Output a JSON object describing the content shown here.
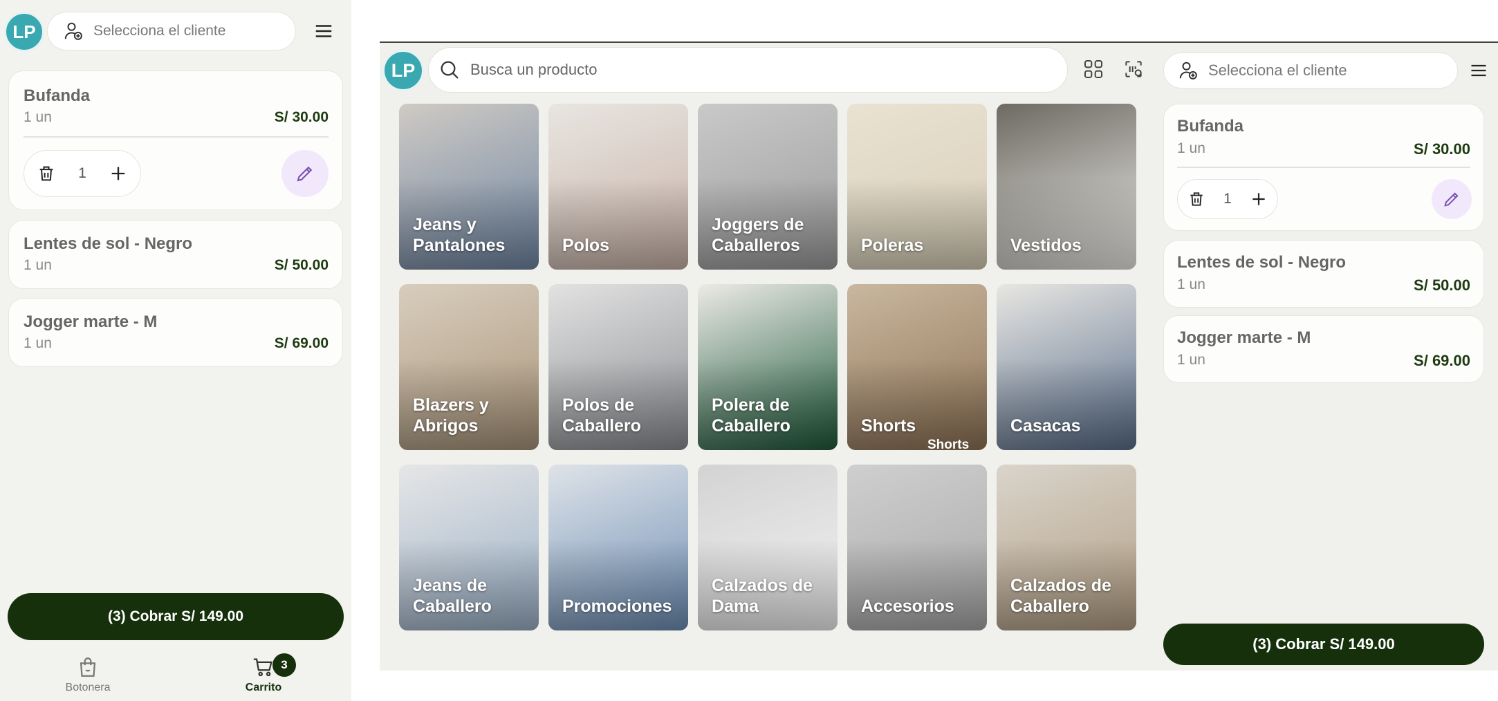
{
  "user": {
    "initials": "LP"
  },
  "client_picker": {
    "placeholder": "Selecciona el cliente"
  },
  "search": {
    "placeholder": "Busca un producto"
  },
  "cart": {
    "items": [
      {
        "name": "Bufanda",
        "qty": "1 un",
        "price": "S/ 30.00",
        "count": "1"
      },
      {
        "name": "Lentes de sol - Negro",
        "qty": "1 un",
        "price": "S/ 50.00"
      },
      {
        "name": "Jogger marte - M",
        "qty": "1 un",
        "price": "S/ 69.00"
      }
    ],
    "charge_label": "(3) Cobrar S/ 149.00"
  },
  "nav": {
    "botonera": "Botonera",
    "carrito": "Carrito",
    "carrito_badge": "3"
  },
  "categories": [
    {
      "label": "Jeans y\nPantalones",
      "colors": [
        "#cfcac4",
        "#6f86a3"
      ]
    },
    {
      "label": "Polos",
      "colors": [
        "#e8e5e1",
        "#c9b3a8"
      ]
    },
    {
      "label": "Joggers de\nCaballeros",
      "colors": [
        "#c9c9c9",
        "#9b9b9b"
      ]
    },
    {
      "label": "Poleras",
      "colors": [
        "#e9e2d2",
        "#d8cfb8"
      ]
    },
    {
      "label": "Vestidos",
      "colors": [
        "#6d6a62",
        "#efeeea"
      ]
    },
    {
      "label": "Blazers y\nAbrigos",
      "colors": [
        "#d8cdbd",
        "#a9957a"
      ]
    },
    {
      "label": "Polos de\nCaballero",
      "colors": [
        "#e2e2e2",
        "#8c8e93"
      ]
    },
    {
      "label": "Polera de\nCaballero",
      "colors": [
        "#eceae6",
        "#1e5a3a"
      ]
    },
    {
      "label": "Shorts",
      "colors": [
        "#c9b79f",
        "#8e7356"
      ],
      "extra": "Shorts"
    },
    {
      "label": "Casacas",
      "colors": [
        "#e8e6e2",
        "#5a6f8c"
      ]
    },
    {
      "label": "Jeans de\nCaballero",
      "colors": [
        "#e6e6e6",
        "#9bb1c8"
      ]
    },
    {
      "label": "Promociones",
      "colors": [
        "#dfe3e8",
        "#6e8fb5"
      ]
    },
    {
      "label": "Calzados de\nDama",
      "colors": [
        "#d3d3d3",
        "#f2f2f2"
      ]
    },
    {
      "label": "Accesorios",
      "colors": [
        "#cfcfcf",
        "#a8a8a8"
      ]
    },
    {
      "label": "Calzados de\nCaballero",
      "colors": [
        "#d9d4cc",
        "#b39f83"
      ]
    }
  ]
}
